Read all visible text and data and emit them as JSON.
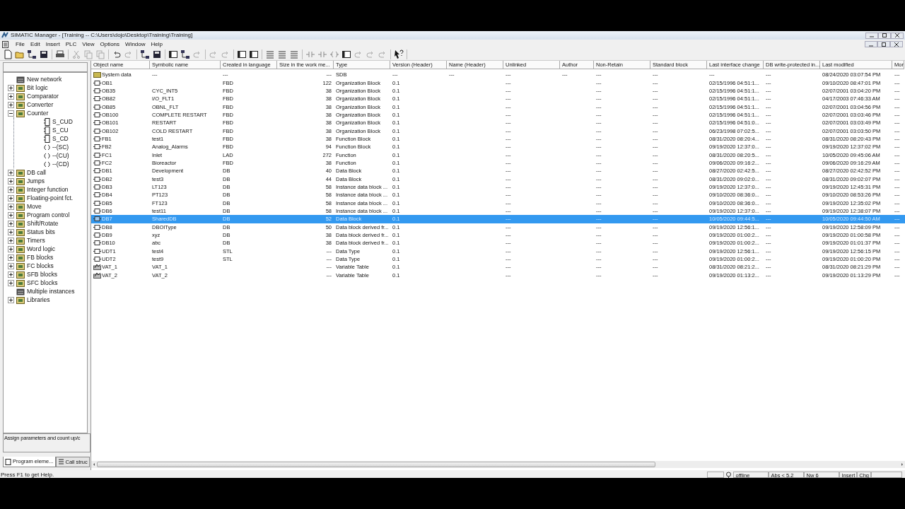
{
  "window": {
    "title": "SIMATIC Manager - [Training -- C:\\Users\\dojo\\Desktop\\Training\\Training]",
    "menu": [
      "File",
      "Edit",
      "Insert",
      "PLC",
      "View",
      "Options",
      "Window",
      "Help"
    ]
  },
  "program_elements": {
    "tree": [
      {
        "label": "New network",
        "kind": "leaf"
      },
      {
        "label": "Bit logic",
        "kind": "folder",
        "expanded": false
      },
      {
        "label": "Comparator",
        "kind": "folder",
        "expanded": false
      },
      {
        "label": "Converter",
        "kind": "folder",
        "expanded": false
      },
      {
        "label": "Counter",
        "kind": "folder",
        "expanded": true,
        "children": [
          {
            "label": "S_CUD",
            "kind": "box"
          },
          {
            "label": "S_CU",
            "kind": "box"
          },
          {
            "label": "S_CD",
            "kind": "box"
          },
          {
            "label": "--(SC)",
            "kind": "coil"
          },
          {
            "label": "--(CU)",
            "kind": "coil"
          },
          {
            "label": "--(CD)",
            "kind": "coil"
          }
        ]
      },
      {
        "label": "DB call",
        "kind": "folder",
        "expanded": false
      },
      {
        "label": "Jumps",
        "kind": "folder",
        "expanded": false
      },
      {
        "label": "Integer function",
        "kind": "folder",
        "expanded": false
      },
      {
        "label": "Floating-point fct.",
        "kind": "folder",
        "expanded": false
      },
      {
        "label": "Move",
        "kind": "folder",
        "expanded": false
      },
      {
        "label": "Program control",
        "kind": "folder",
        "expanded": false
      },
      {
        "label": "Shift/Rotate",
        "kind": "folder",
        "expanded": false
      },
      {
        "label": "Status bits",
        "kind": "folder",
        "expanded": false
      },
      {
        "label": "Timers",
        "kind": "folder",
        "expanded": false
      },
      {
        "label": "Word logic",
        "kind": "folder",
        "expanded": false
      },
      {
        "label": "FB blocks",
        "kind": "folder",
        "expanded": false
      },
      {
        "label": "FC blocks",
        "kind": "folder",
        "expanded": false
      },
      {
        "label": "SFB blocks",
        "kind": "folder",
        "expanded": false
      },
      {
        "label": "SFC blocks",
        "kind": "folder",
        "expanded": false
      },
      {
        "label": "Multiple instances",
        "kind": "leaf"
      },
      {
        "label": "Libraries",
        "kind": "folder",
        "expanded": false
      }
    ],
    "description": "Assign parameters and count up/c",
    "tabs": [
      {
        "label": "Program eleme...",
        "selected": true
      },
      {
        "label": "Call struc",
        "selected": false
      }
    ]
  },
  "table": {
    "columns": [
      "Object name",
      "Symbolic name",
      "Created in language",
      "Size in the work me...",
      "Type",
      "Version (Header)",
      "Name (Header)",
      "Unlinked",
      "Author",
      "Non-Retain",
      "Standard block",
      "Last interface change",
      "DB write-protected in...",
      "Last modified",
      "Mor"
    ],
    "rows": [
      {
        "kind": "folder",
        "selected": false,
        "cells": [
          "System data",
          "---",
          "---",
          "---",
          "SDB",
          "---",
          "---",
          "---",
          "---",
          "---",
          "---",
          "---",
          "---",
          "08/24/2020 03:07:54 PM",
          "---"
        ]
      },
      {
        "kind": "block",
        "selected": false,
        "cells": [
          "OB1",
          null,
          "FBD",
          "122",
          "Organization Block",
          "0.1",
          null,
          "---",
          null,
          "---",
          "---",
          "02/15/1996 04:51:1...",
          "---",
          "09/10/2020 08:47:01 PM",
          "---"
        ]
      },
      {
        "kind": "block",
        "selected": false,
        "cells": [
          "OB35",
          "CYC_INT5",
          "FBD",
          "38",
          "Organization Block",
          "0.1",
          null,
          "---",
          null,
          "---",
          "---",
          "02/15/1996 04:51:1...",
          "---",
          "02/07/2001 03:04:20 PM",
          "---"
        ]
      },
      {
        "kind": "block",
        "selected": false,
        "cells": [
          "OB82",
          "I/O_FLT1",
          "FBD",
          "38",
          "Organization Block",
          "0.1",
          null,
          "---",
          null,
          "---",
          "---",
          "02/15/1996 04:51:1...",
          "---",
          "04/17/2003 07:46:33 AM",
          "---"
        ]
      },
      {
        "kind": "block",
        "selected": false,
        "cells": [
          "OB85",
          "OBNL_FLT",
          "FBD",
          "38",
          "Organization Block",
          "0.1",
          null,
          "---",
          null,
          "---",
          "---",
          "02/15/1996 04:51:1...",
          "---",
          "02/07/2001 03:04:56 PM",
          "---"
        ]
      },
      {
        "kind": "block",
        "selected": false,
        "cells": [
          "OB100",
          "COMPLETE RESTART",
          "FBD",
          "38",
          "Organization Block",
          "0.1",
          null,
          "---",
          null,
          "---",
          "---",
          "02/15/1996 04:51:1...",
          "---",
          "02/07/2001 03:03:46 PM",
          "---"
        ]
      },
      {
        "kind": "block",
        "selected": false,
        "cells": [
          "OB101",
          "RESTART",
          "FBD",
          "38",
          "Organization Block",
          "0.1",
          null,
          "---",
          null,
          "---",
          "---",
          "02/15/1996 04:51:0...",
          "---",
          "02/07/2001 03:03:49 PM",
          "---"
        ]
      },
      {
        "kind": "block",
        "selected": false,
        "cells": [
          "OB102",
          "COLD RESTART",
          "FBD",
          "38",
          "Organization Block",
          "0.1",
          null,
          "---",
          null,
          "---",
          "---",
          "06/23/1998 07:02:5...",
          "---",
          "02/07/2001 03:03:50 PM",
          "---"
        ]
      },
      {
        "kind": "block",
        "selected": false,
        "cells": [
          "FB1",
          "test1",
          "FBD",
          "38",
          "Function Block",
          "0.1",
          null,
          "---",
          null,
          "---",
          "---",
          "08/31/2020 08:20:4...",
          "---",
          "08/31/2020 08:20:43 PM",
          "---"
        ]
      },
      {
        "kind": "block",
        "selected": false,
        "cells": [
          "FB2",
          "Analog_Alarms",
          "FBD",
          "94",
          "Function Block",
          "0.1",
          null,
          "---",
          null,
          "---",
          "---",
          "09/19/2020 12:37:0...",
          "---",
          "09/19/2020 12:37:02 PM",
          "---"
        ]
      },
      {
        "kind": "block",
        "selected": false,
        "cells": [
          "FC1",
          "Inlet",
          "LAD",
          "272",
          "Function",
          "0.1",
          null,
          "---",
          null,
          "---",
          "---",
          "08/31/2020 08:20:5...",
          "---",
          "10/05/2020 09:45:06 AM",
          "---"
        ]
      },
      {
        "kind": "block",
        "selected": false,
        "cells": [
          "FC2",
          "Bioreactor",
          "FBD",
          "38",
          "Function",
          "0.1",
          null,
          "---",
          null,
          "---",
          "---",
          "09/06/2020 09:16:2...",
          "---",
          "09/06/2020 09:16:29 AM",
          "---"
        ]
      },
      {
        "kind": "block",
        "selected": false,
        "cells": [
          "DB1",
          "Development",
          "DB",
          "40",
          "Data Block",
          "0.1",
          null,
          "---",
          null,
          "---",
          "---",
          "08/27/2020 02:42:5...",
          "---",
          "08/27/2020 02:42:52 PM",
          "---"
        ]
      },
      {
        "kind": "block",
        "selected": false,
        "cells": [
          "DB2",
          "test3",
          "DB",
          "44",
          "Data Block",
          "0.1",
          null,
          "---",
          null,
          "---",
          "---",
          "08/31/2020 09:02:0...",
          "---",
          "08/31/2020 09:02:07 PM",
          "---"
        ]
      },
      {
        "kind": "block",
        "selected": false,
        "cells": [
          "DB3",
          "LT123",
          "DB",
          "58",
          "Instance data block ...",
          "0.1",
          null,
          "---",
          null,
          "---",
          "---",
          "09/19/2020 12:37:0...",
          "---",
          "09/19/2020 12:45:31 PM",
          "---"
        ]
      },
      {
        "kind": "block",
        "selected": false,
        "cells": [
          "DB4",
          "PT123",
          "DB",
          "58",
          "Instance data block ...",
          "0.1",
          null,
          "---",
          null,
          "---",
          "---",
          "09/10/2020 08:36:0...",
          "---",
          "09/10/2020 08:53:26 PM",
          "---"
        ]
      },
      {
        "kind": "block",
        "selected": false,
        "cells": [
          "DB5",
          "FT123",
          "DB",
          "58",
          "Instance data block ...",
          "0.1",
          null,
          "---",
          null,
          "---",
          "---",
          "09/10/2020 08:36:0...",
          "---",
          "09/19/2020 12:35:02 PM",
          "---"
        ]
      },
      {
        "kind": "block",
        "selected": false,
        "cells": [
          "DB6",
          "test11",
          "DB",
          "58",
          "Instance data block ...",
          "0.1",
          null,
          "---",
          null,
          "---",
          "---",
          "09/19/2020 12:37:0...",
          "---",
          "09/19/2020 12:38:07 PM",
          "---"
        ]
      },
      {
        "kind": "block",
        "selected": true,
        "cells": [
          "DB7",
          "SharedDB",
          "DB",
          "52",
          "Data Block",
          "0.1",
          null,
          "---",
          null,
          "---",
          "---",
          "10/05/2020 09:44:5...",
          "---",
          "10/05/2020 09:44:50 AM",
          "---"
        ]
      },
      {
        "kind": "block",
        "selected": false,
        "cells": [
          "DB8",
          "DBOIType",
          "DB",
          "50",
          "Data block derived fr...",
          "0.1",
          null,
          "---",
          null,
          "---",
          "---",
          "09/19/2020 12:56:1...",
          "---",
          "09/19/2020 12:58:09 PM",
          "---"
        ]
      },
      {
        "kind": "block",
        "selected": false,
        "cells": [
          "DB9",
          "xyz",
          "DB",
          "38",
          "Data block derived fr...",
          "0.1",
          null,
          "---",
          null,
          "---",
          "---",
          "09/19/2020 01:00:2...",
          "---",
          "09/19/2020 01:00:58 PM",
          "---"
        ]
      },
      {
        "kind": "block",
        "selected": false,
        "cells": [
          "DB10",
          "abc",
          "DB",
          "38",
          "Data block derived fr...",
          "0.1",
          null,
          "---",
          null,
          "---",
          "---",
          "09/19/2020 01:00:2...",
          "---",
          "09/19/2020 01:01:37 PM",
          "---"
        ]
      },
      {
        "kind": "block",
        "selected": false,
        "cells": [
          "UDT1",
          "test4",
          "STL",
          "---",
          "Data Type",
          "0.1",
          null,
          "---",
          null,
          "---",
          "---",
          "09/19/2020 12:56:1...",
          "---",
          "09/19/2020 12:56:15 PM",
          "---"
        ]
      },
      {
        "kind": "block",
        "selected": false,
        "cells": [
          "UDT2",
          "test9",
          "STL",
          "---",
          "Data Type",
          "0.1",
          null,
          "---",
          null,
          "---",
          "---",
          "09/19/2020 01:00:2...",
          "---",
          "09/19/2020 01:00:20 PM",
          "---"
        ]
      },
      {
        "kind": "vartable",
        "selected": false,
        "cells": [
          "VAT_1",
          "VAT_1",
          null,
          "---",
          "Variable Table",
          "0.1",
          null,
          "---",
          null,
          "---",
          "---",
          "08/31/2020 08:21:2...",
          "---",
          "08/31/2020 08:21:29 PM",
          "---"
        ]
      },
      {
        "kind": "vartable",
        "selected": false,
        "cells": [
          "VAT_2",
          "VAT_2",
          null,
          "---",
          "Variable Table",
          "0.1",
          null,
          "---",
          null,
          "---",
          "---",
          "09/19/2020 01:13:2...",
          "---",
          "09/19/2020 01:13:29 PM",
          "---"
        ]
      }
    ]
  },
  "status_bar": {
    "help": "Press F1 to get Help.",
    "fields": [
      "offline",
      "Abs < 5.2",
      "Nw 6",
      "Insert",
      "Chg"
    ]
  }
}
